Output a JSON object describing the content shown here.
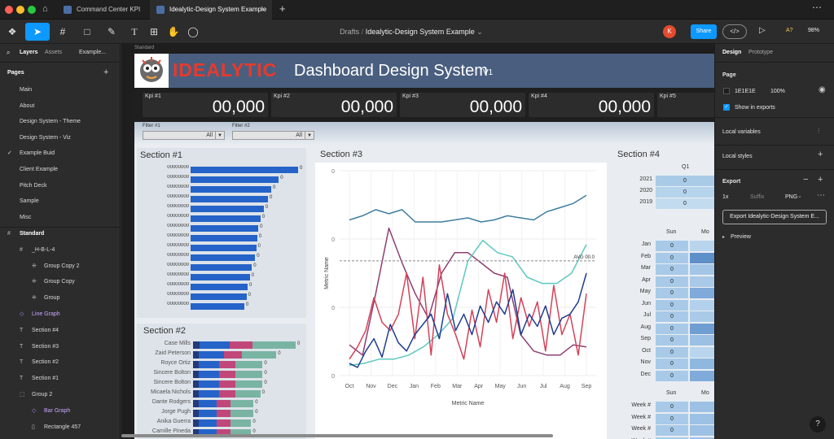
{
  "tabs": [
    {
      "label": "Command Center KPI"
    },
    {
      "label": "Idealytic-Design System Example"
    }
  ],
  "toolbar": {
    "breadcrumb_root": "Drafts",
    "breadcrumb_sep": "/",
    "file_name": "Idealytic-Design System Example",
    "avatar_initial": "K",
    "share_label": "Share",
    "a_badge": "A?",
    "zoom": "98%"
  },
  "left": {
    "tab_layers": "Layers",
    "tab_assets": "Assets",
    "tab_page": "Example...",
    "pages_label": "Pages",
    "pages": [
      "Main",
      "About",
      "Design System - Theme",
      "Design System - Viz",
      "Example Buid",
      "Client Example",
      "Pitch Deck",
      "Sample",
      "Misc"
    ],
    "layers": [
      {
        "label": "Standard",
        "icon": "frame-icon",
        "indent": 0
      },
      {
        "label": "_H-B-L-4",
        "icon": "frame-icon",
        "indent": 1
      },
      {
        "label": "Group Copy 2",
        "icon": "grid-icon",
        "indent": 2
      },
      {
        "label": "Group Copy",
        "icon": "grid-icon",
        "indent": 2
      },
      {
        "label": "Group",
        "icon": "grid-icon",
        "indent": 2
      },
      {
        "label": "Line Graph",
        "icon": "component-icon",
        "indent": 1
      },
      {
        "label": "Section #4",
        "icon": "text-icon",
        "indent": 1
      },
      {
        "label": "Section #3",
        "icon": "text-icon",
        "indent": 1
      },
      {
        "label": "Section #2",
        "icon": "text-icon",
        "indent": 1
      },
      {
        "label": "Section #1",
        "icon": "text-icon",
        "indent": 1
      },
      {
        "label": "Group 2",
        "icon": "group-icon",
        "indent": 1
      },
      {
        "label": "Bar Graph",
        "icon": "component-icon",
        "indent": 2
      },
      {
        "label": "Rectangle 457",
        "icon": "rect-icon",
        "indent": 2
      }
    ]
  },
  "right": {
    "tab_design": "Design",
    "tab_prototype": "Prototype",
    "page_label": "Page",
    "page_color": "1E1E1E",
    "page_opacity": "100%",
    "show_exports": "Show in exports",
    "local_variables": "Local variables",
    "local_styles": "Local styles",
    "export_label": "Export",
    "export_scale": "1x",
    "export_suffix": "Suffix",
    "export_format": "PNG",
    "export_button": "Export Idealytic-Design System E...",
    "preview": "Preview",
    "help": "?"
  },
  "canvas": {
    "frame_label": "Standard",
    "header": {
      "logo_text": "IDEALYTIC",
      "title": "Dashboard Design System",
      "version": "V1"
    },
    "kpis": [
      {
        "label": "Kpi #1",
        "value": "00,000"
      },
      {
        "label": "Kpi #2",
        "value": "00,000"
      },
      {
        "label": "Kpi #3",
        "value": "00,000"
      },
      {
        "label": "Kpi #4",
        "value": "00,000"
      },
      {
        "label": "Kpi #5",
        "value": ""
      }
    ],
    "filters": [
      {
        "label": "Filter #1",
        "value": "All"
      },
      {
        "label": "Filter #2",
        "value": "All"
      }
    ],
    "section1": {
      "title": "Section #1"
    },
    "section2": {
      "title": "Section #2"
    },
    "section3": {
      "title": "Section #3"
    },
    "section4": {
      "title": "Section #4",
      "col_q1": "Q1",
      "years": [
        "2021",
        "2020",
        "2019"
      ],
      "col_sun": "Sun",
      "col_mon": "Mo",
      "months": [
        "Jan",
        "Feb",
        "Mar",
        "Apr",
        "May",
        "Jun",
        "Jul",
        "Aug",
        "Sep",
        "Oct",
        "Nov",
        "Dec"
      ],
      "weeks": [
        "Week #",
        "Week #",
        "Week #",
        "Week #"
      ],
      "cell": "0"
    }
  },
  "chart_data": [
    {
      "type": "bar",
      "title": "Section #1",
      "categories": [
        "00000000",
        "00000000",
        "00000000",
        "00000000",
        "00000000",
        "00000000",
        "00000000",
        "00000000",
        "00000000",
        "00000000",
        "00000000",
        "00000000",
        "00000000",
        "00000000",
        "00000000"
      ],
      "values": [
        100,
        82,
        75,
        72,
        68,
        65,
        63,
        62,
        61,
        60,
        57,
        55,
        53,
        52,
        50
      ],
      "data_label": "0",
      "color": "#2563c9"
    },
    {
      "type": "bar",
      "title": "Section #2",
      "stacked": true,
      "categories": [
        "Case Mills",
        "Zaid Peterson",
        "Royce Ortiz",
        "Sincere Bolton",
        "Sincere Bolton",
        "Micaela Nichols",
        "Dante Rodgers",
        "Jorge Pugh",
        "Anika Guerra",
        "Camille Pineda"
      ],
      "series": [
        {
          "color": "#23397a",
          "values": [
            6,
            5,
            5,
            5,
            5,
            5,
            5,
            5,
            5,
            5
          ]
        },
        {
          "color": "#2563c9",
          "values": [
            26,
            22,
            18,
            18,
            18,
            18,
            16,
            16,
            16,
            16
          ]
        },
        {
          "color": "#c1477a",
          "values": [
            20,
            16,
            14,
            14,
            14,
            14,
            12,
            12,
            12,
            12
          ]
        },
        {
          "color": "#79b4a3",
          "values": [
            38,
            30,
            24,
            24,
            24,
            22,
            20,
            20,
            18,
            18
          ]
        }
      ],
      "data_label": "0"
    },
    {
      "type": "line",
      "title": "Section #3",
      "xlabel": "Metric Name",
      "ylabel": "Metric Name",
      "categories": [
        "Oct",
        "Nov",
        "Dec",
        "Jan",
        "Feb",
        "Mar",
        "Apr",
        "May",
        "Jun",
        "Jul",
        "Aug",
        "Sep"
      ],
      "yticks": [
        "0",
        "0",
        "0",
        "0"
      ],
      "ylim": [
        0,
        100
      ],
      "avg_label": "AVG 00.0",
      "avg_value": 56,
      "grid": true,
      "series": [
        {
          "color": "#3f7f9f",
          "values": [
            76,
            78,
            81,
            79,
            81,
            75,
            75,
            75,
            76,
            77,
            75,
            76,
            78,
            77,
            76,
            80,
            82,
            84,
            88
          ]
        },
        {
          "color": "#8e3f73",
          "values": [
            15,
            10,
            40,
            72,
            55,
            40,
            28,
            50,
            60,
            60,
            55,
            50,
            48,
            20,
            12,
            10,
            10,
            15,
            14
          ]
        },
        {
          "color": "#5ec8c0",
          "values": [
            5,
            6,
            8,
            8,
            10,
            14,
            20,
            28,
            56,
            66,
            60,
            58,
            48,
            45,
            45,
            50,
            64
          ]
        },
        {
          "color": "#d4425a",
          "values": [
            8,
            14,
            22,
            38,
            26,
            22,
            30,
            50,
            18,
            48,
            10,
            54,
            30,
            20,
            8,
            32,
            14,
            42,
            26,
            50,
            18,
            38,
            24,
            36,
            12,
            44,
            20,
            30,
            10,
            40
          ]
        },
        {
          "color": "#1f3e8f",
          "values": [
            6,
            4,
            12,
            18,
            9,
            25,
            16,
            12,
            20,
            25,
            30,
            18,
            40,
            22,
            30,
            20,
            34,
            26,
            36,
            30,
            42,
            20,
            30,
            24,
            34,
            20,
            28,
            30,
            36,
            50
          ]
        }
      ]
    }
  ]
}
